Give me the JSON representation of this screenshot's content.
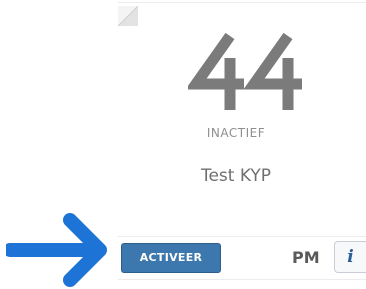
{
  "card": {
    "number": "44",
    "status": "INACTIEF",
    "name": "Test KYP"
  },
  "actions": {
    "activate_label": "ACTIVEER",
    "period_label": "PM",
    "info_glyph": "i"
  },
  "icons": {
    "logo": "number-44-logo",
    "corner": "corner-fold-icon",
    "info": "info-icon",
    "pointer": "arrow-right-icon"
  },
  "colors": {
    "activate_button": "#3c78ad",
    "logo_gray": "#7b7b7b",
    "pointer_arrow": "#1e73d6",
    "info_glyph": "#2b5f97"
  }
}
